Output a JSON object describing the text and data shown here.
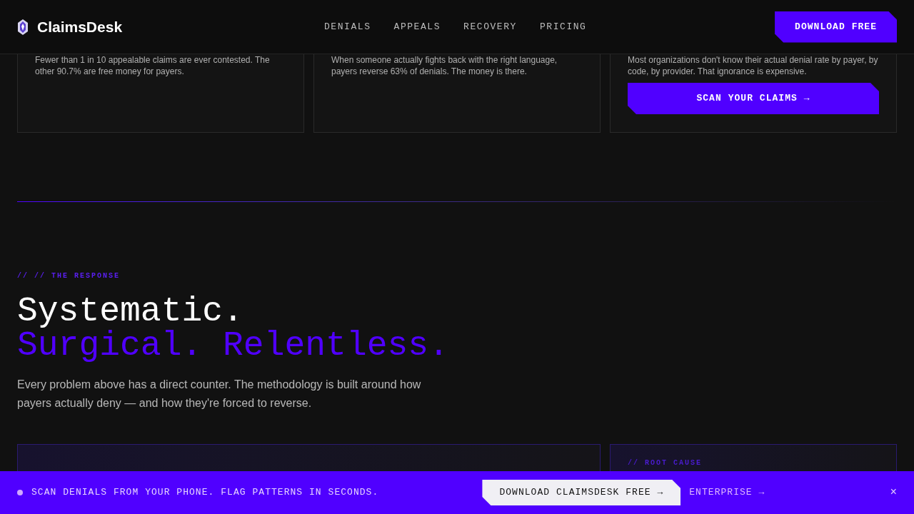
{
  "header": {
    "brand": "ClaimsDesk",
    "nav": [
      {
        "label": "DENIALS"
      },
      {
        "label": "APPEALS"
      },
      {
        "label": "RECOVERY"
      },
      {
        "label": "PRICING"
      }
    ],
    "cta": "DOWNLOAD FREE"
  },
  "problem_cards": [
    {
      "text": "Fewer than 1 in 10 appealable claims are ever contested. The other 90.7% are free money for payers."
    },
    {
      "text": "When someone actually fights back with the right language, payers reverse 63% of denials. The money is there."
    },
    {
      "text": "Most organizations don't know their actual denial rate by payer, by code, by provider. That ignorance is expensive.",
      "button": "SCAN YOUR CLAIMS →"
    }
  ],
  "response": {
    "eyebrow": "// // THE RESPONSE",
    "title_line_1": "Systematic.",
    "title_line_2": "Surgical. Relentless.",
    "body": "Every problem above has a direct counter. The methodology is built around how payers actually deny — and how they're forced to reverse."
  },
  "root_cause_card": {
    "label": "// ROOT CAUSE"
  },
  "banner": {
    "message": "SCAN DENIALS FROM YOUR PHONE. FLAG PATTERNS IN SECONDS.",
    "primary": "DOWNLOAD CLAIMSDESK FREE →",
    "secondary": "ENTERPRISE →",
    "close": "×"
  }
}
